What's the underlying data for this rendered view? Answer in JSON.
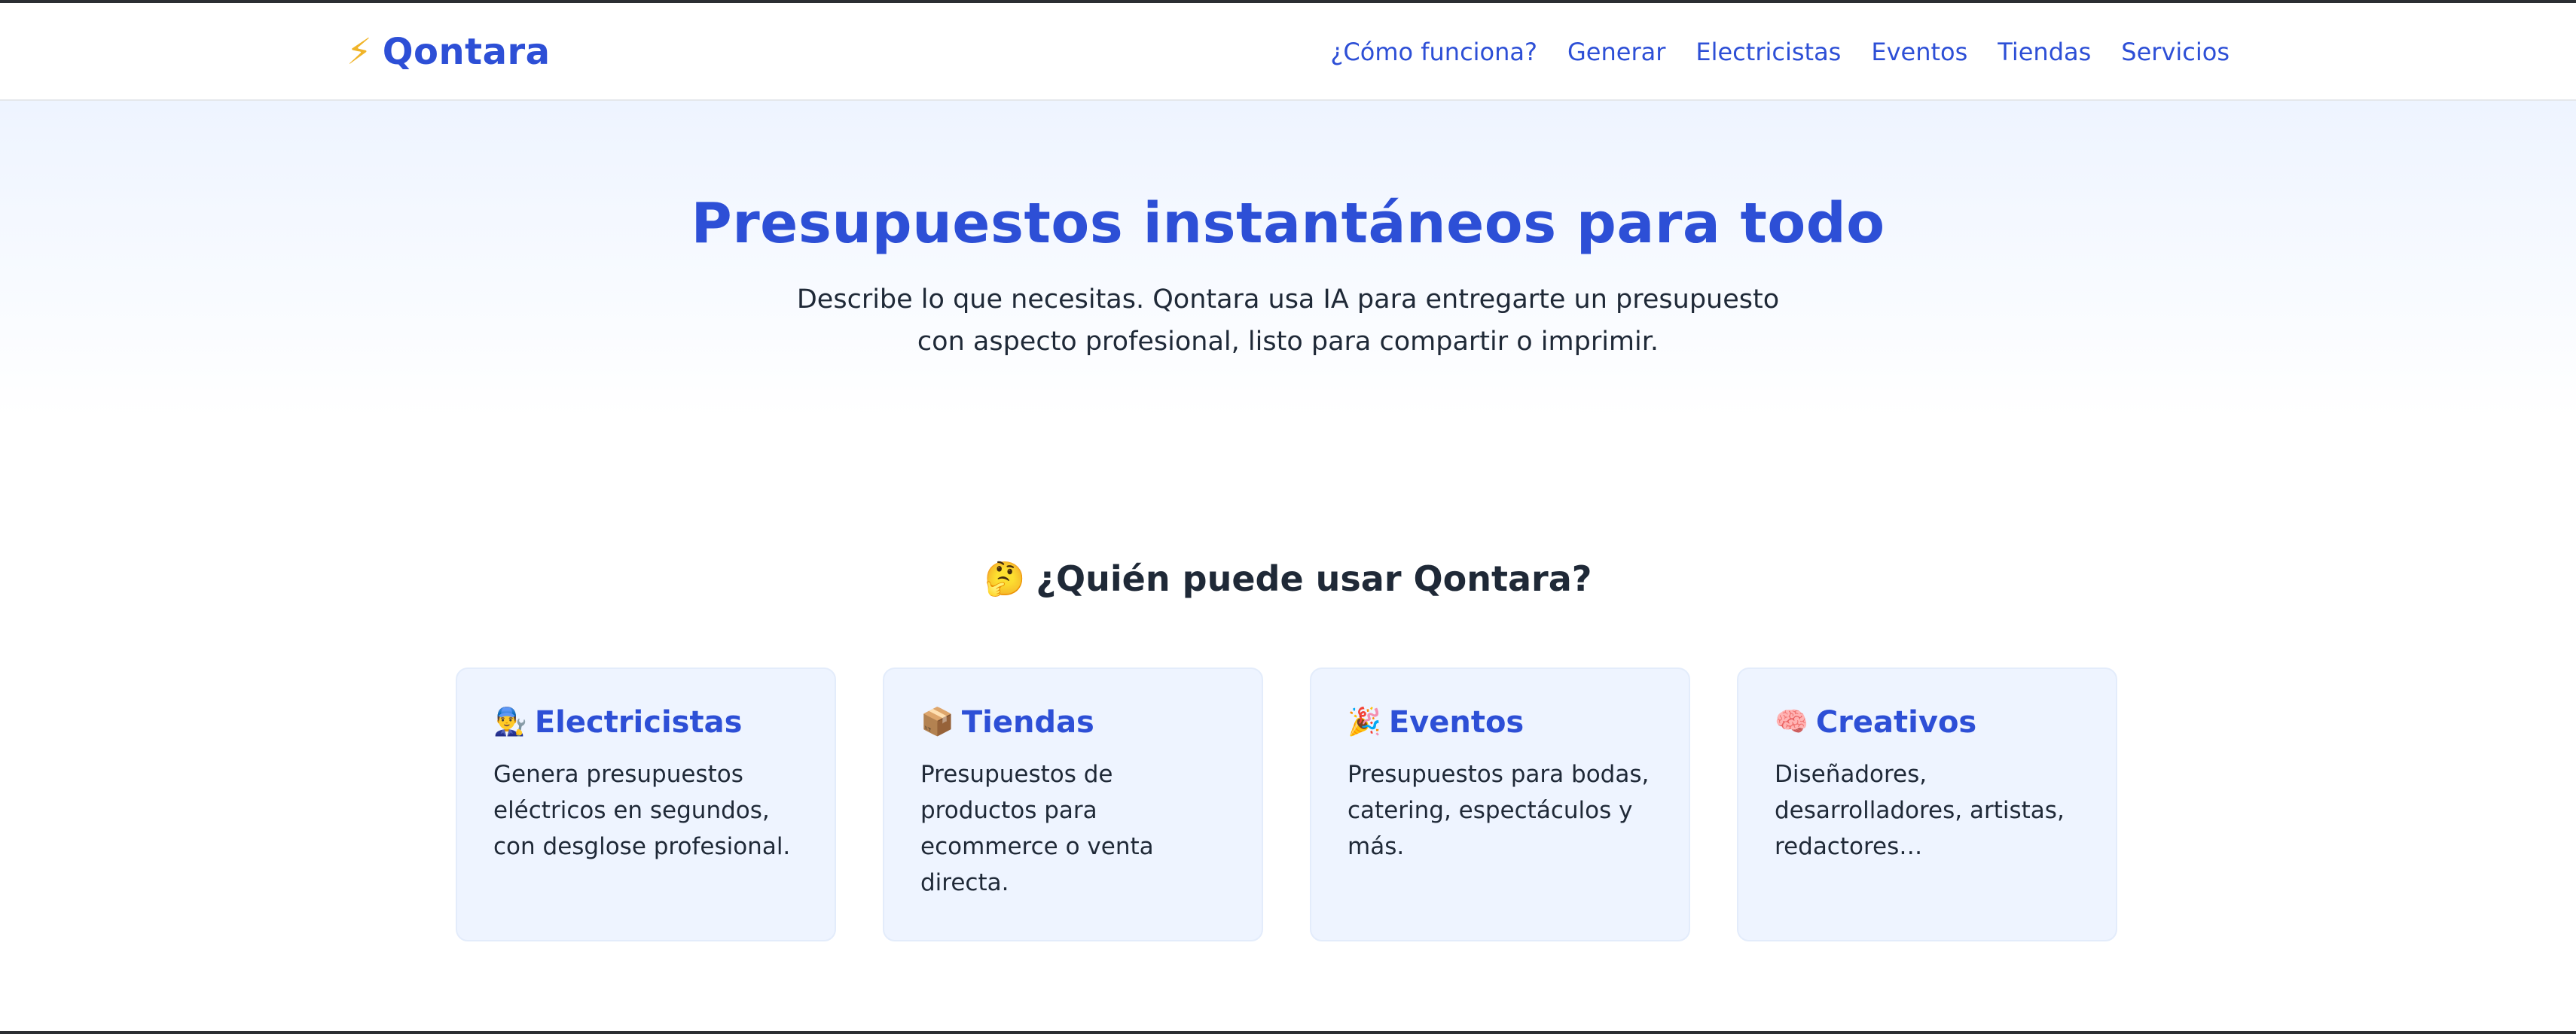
{
  "header": {
    "brand_icon": "⚡",
    "brand_name": "Qontara",
    "nav": [
      {
        "label": "¿Cómo funciona?"
      },
      {
        "label": "Generar"
      },
      {
        "label": "Electricistas"
      },
      {
        "label": "Eventos"
      },
      {
        "label": "Tiendas"
      },
      {
        "label": "Servicios"
      }
    ]
  },
  "hero": {
    "title": "Presupuestos instantáneos para todo",
    "subtitle": "Describe lo que necesitas. Qontara usa IA para entregarte un presupuesto con aspecto profesional, listo para compartir o imprimir."
  },
  "who": {
    "emoji": "🤔",
    "title": "¿Quién puede usar Qontara?",
    "cards": [
      {
        "emoji": "👨‍🔧",
        "icon": "electrician-icon",
        "title": "Electricistas",
        "text": "Genera presupuestos eléctricos en segundos, con desglose profesional."
      },
      {
        "emoji": "📦",
        "icon": "package-icon",
        "title": "Tiendas",
        "text": "Presupuestos de productos para ecommerce o venta directa."
      },
      {
        "emoji": "🎉",
        "icon": "party-popper-icon",
        "title": "Eventos",
        "text": "Presupuestos para bodas, catering, espectáculos y más."
      },
      {
        "emoji": "🧠",
        "icon": "brain-icon",
        "title": "Creativos",
        "text": "Diseñadores, desarrolladores, artistas, redactores…"
      }
    ]
  },
  "colors": {
    "brand_blue": "#2d4fd6",
    "bolt_yellow": "#f0b429",
    "card_bg": "#eef4ff",
    "text_dark": "#1f2937"
  }
}
